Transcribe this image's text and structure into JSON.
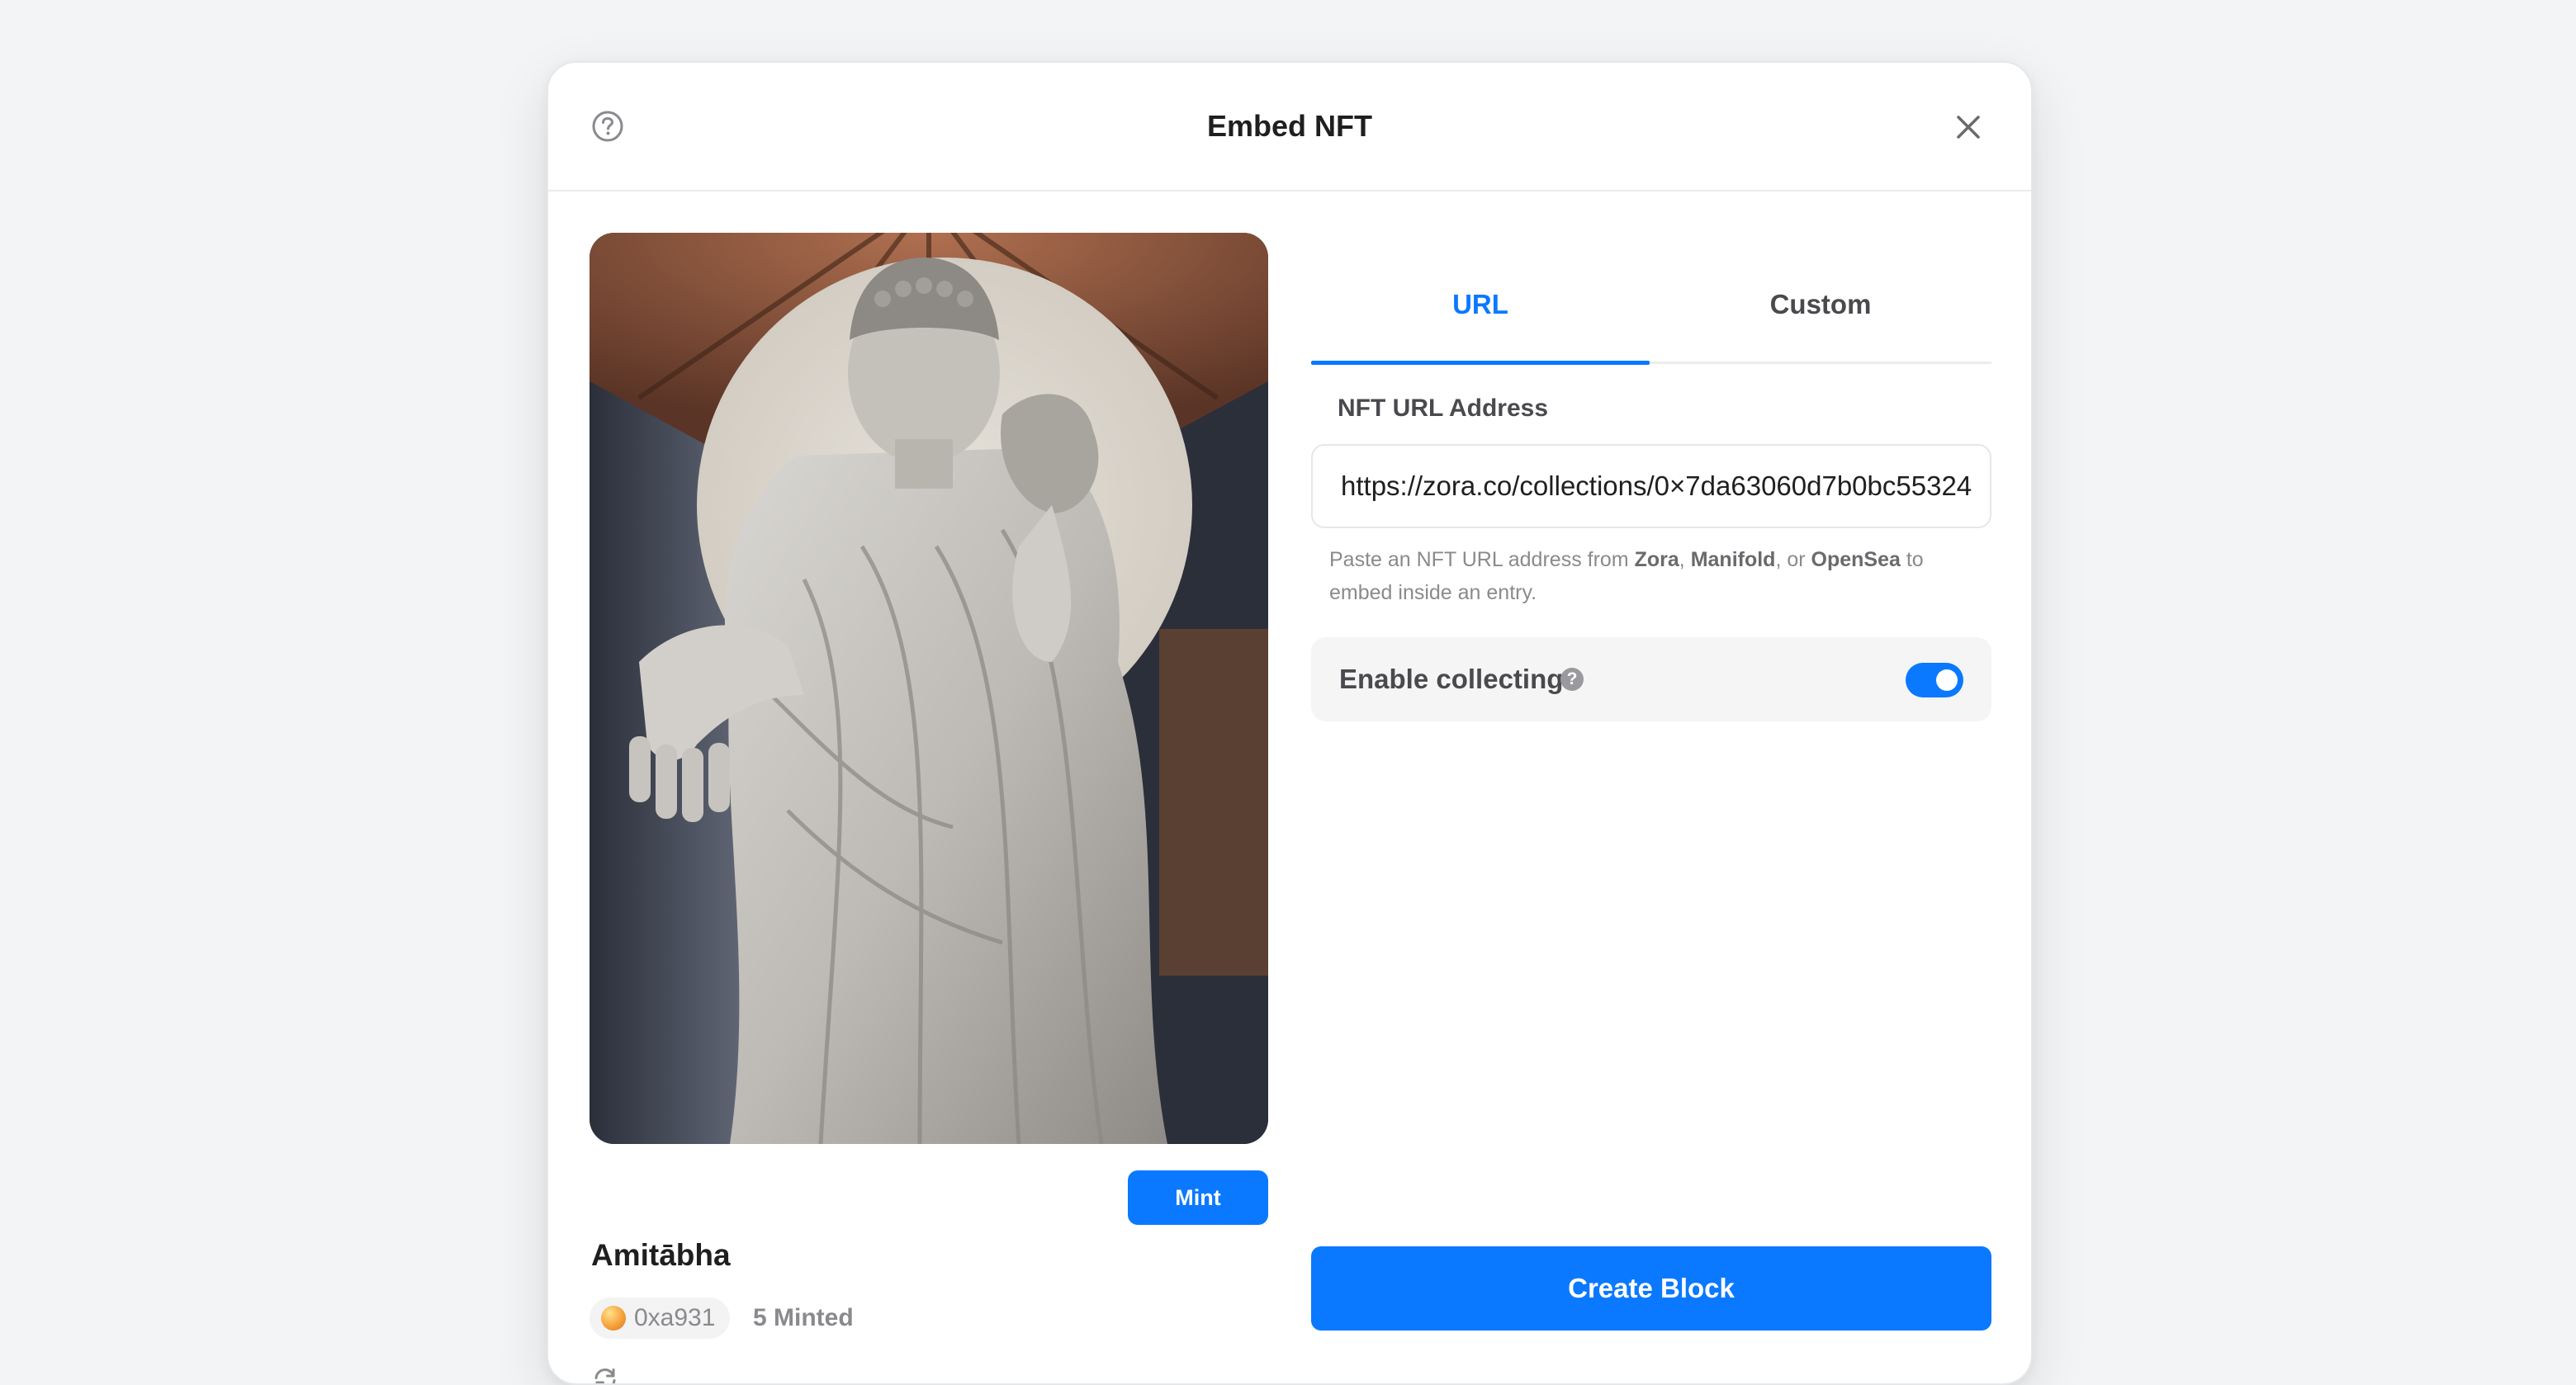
{
  "header": {
    "title": "Embed NFT",
    "help_icon": "question-circle-icon",
    "close_icon": "close-icon"
  },
  "preview": {
    "image_alt": "Amitābha statue",
    "title": "Amitābha",
    "mint_label": "Mint",
    "owner_address": "0xa931",
    "minted": "5 Minted",
    "refresh_icon": "refresh-icon"
  },
  "tabs": [
    {
      "label": "URL",
      "active": true
    },
    {
      "label": "Custom",
      "active": false
    }
  ],
  "url_field": {
    "label": "NFT URL Address",
    "value": "https://zora.co/collections/0×7da63060d7b0bc55324"
  },
  "help": {
    "prefix": "Paste an NFT URL address from ",
    "zora": "Zora",
    "sep1": ", ",
    "manifold": "Manifold",
    "sep2": ", or ",
    "opensea": "OpenSea",
    "suffix": " to embed inside an entry."
  },
  "collecting": {
    "label": "Enable collecting",
    "info_glyph": "?",
    "enabled": true
  },
  "actions": {
    "create_label": "Create Block"
  },
  "colors": {
    "accent": "#0a79ff",
    "background": "#f3f4f6"
  }
}
